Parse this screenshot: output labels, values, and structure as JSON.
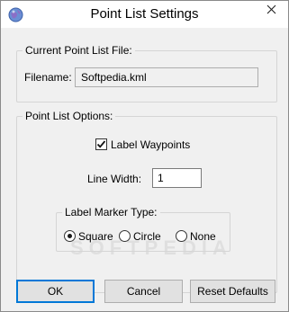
{
  "window": {
    "title": "Point List Settings"
  },
  "file_group": {
    "legend": "Current Point List File:",
    "filename_label": "Filename:",
    "filename_value": "Softpedia.kml"
  },
  "options_group": {
    "legend": "Point List Options:",
    "label_waypoints": {
      "label": "Label Waypoints",
      "checked": true
    },
    "line_width": {
      "label": "Line Width:",
      "value": "1"
    },
    "marker_group": {
      "legend": "Label Marker Type:",
      "options": [
        {
          "label": "Square",
          "selected": true
        },
        {
          "label": "Circle",
          "selected": false
        },
        {
          "label": "None",
          "selected": false
        }
      ]
    }
  },
  "buttons": {
    "ok": "OK",
    "cancel": "Cancel",
    "reset": "Reset Defaults"
  },
  "watermark": "SOFTPEDIA",
  "colors": {
    "focus_border": "#0078d7",
    "dialog_bg": "#f0f0f0"
  }
}
